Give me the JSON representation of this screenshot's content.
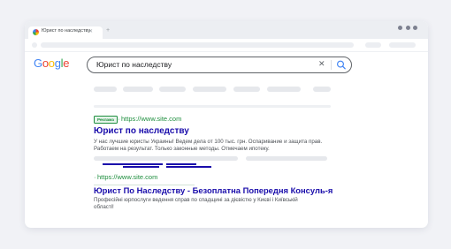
{
  "browser": {
    "tab_title": "Юрист по наследству",
    "tab_close_icon": "close-icon",
    "new_tab_icon": "plus-icon",
    "window_controls": [
      "dot",
      "dot",
      "dot"
    ]
  },
  "google": {
    "logo_letters": [
      {
        "ch": "G",
        "color": "#4285f4"
      },
      {
        "ch": "o",
        "color": "#ea4335"
      },
      {
        "ch": "o",
        "color": "#fbbc05"
      },
      {
        "ch": "g",
        "color": "#4285f4"
      },
      {
        "ch": "l",
        "color": "#34a853"
      },
      {
        "ch": "e",
        "color": "#ea4335"
      }
    ],
    "search_query": "Юрист по наследству",
    "clear_icon": "close-icon",
    "search_icon": "search-icon"
  },
  "results": [
    {
      "badge": "Реклама",
      "url": "https://www.site.com",
      "url_prefix": "·",
      "title": "Юрист по наследству",
      "snippet_lines": [
        "У нас лучшие юристы Украины! Ведем дела от 100 тыс. грн. Оспаривание и защита прав.",
        "Работаем на результат. Только законные методы. Отмечаем ипотеку."
      ]
    },
    {
      "url": "https://www.site.com",
      "url_prefix": "·",
      "title": "Юрист По Наследству - Безоплатна Попередня Консуль-я",
      "snippet_lines": [
        "Професійні юрпослуги ведення справ по спадщині за дієвістю у Києві і Київській",
        "області!"
      ]
    }
  ],
  "colors": {
    "link": "#1a0dab",
    "url_green": "#1e8e3e",
    "snippet": "#4d5156"
  }
}
